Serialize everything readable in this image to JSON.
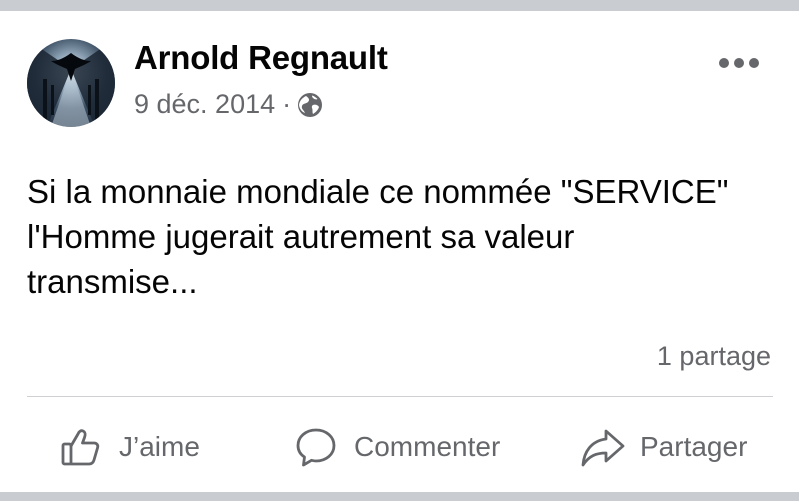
{
  "post": {
    "author": "Arnold Regnault",
    "date": "9 déc. 2014",
    "separator": "·",
    "privacy_icon": "globe-icon",
    "more_icon": "more-options-icon",
    "text_lines": [
      "Si la monnaie mondiale ce nommée \"SERVICE\"",
      "l'Homme jugerait autrement sa valeur",
      "transmise..."
    ],
    "shares": "1 partage"
  },
  "actions": {
    "like": {
      "label": "J’aime",
      "icon": "thumbs-up-icon"
    },
    "comment": {
      "label": "Commenter",
      "icon": "comment-icon"
    },
    "share": {
      "label": "Partager",
      "icon": "share-icon"
    }
  },
  "colors": {
    "page_background": "#c9ccd1",
    "card_background": "#ffffff",
    "primary_text": "#050505",
    "secondary_text": "#65676b",
    "divider": "#ced0d4"
  }
}
